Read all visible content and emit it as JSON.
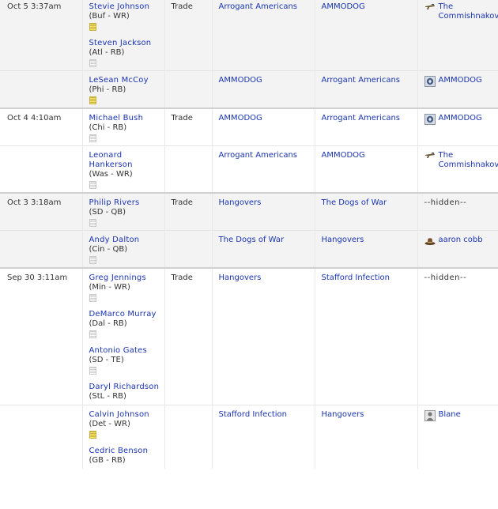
{
  "transactions": [
    {
      "date": "Oct 5 3:37am",
      "type": "Trade",
      "legs": [
        {
          "players": [
            {
              "name": "Stevie Johnson",
              "pos": "(Buf - WR)",
              "note": "yellow"
            },
            {
              "name": "Steven Jackson",
              "pos": "(Atl - RB)",
              "note": "plain"
            }
          ],
          "from": "Arrogant Americans",
          "to": "AMMODOG",
          "manager": "The Commishnakov",
          "manager_icon": "gun-icon"
        },
        {
          "players": [
            {
              "name": "LeSean McCoy",
              "pos": "(Phi - RB)",
              "note": "yellow"
            }
          ],
          "from": "AMMODOG",
          "to": "Arrogant Americans",
          "manager": "AMMODOG",
          "manager_icon": "badge-icon"
        }
      ]
    },
    {
      "date": "Oct 4 4:10am",
      "type": "Trade",
      "legs": [
        {
          "players": [
            {
              "name": "Michael Bush",
              "pos": "(Chi - RB)",
              "note": "plain"
            }
          ],
          "from": "AMMODOG",
          "to": "Arrogant Americans",
          "manager": "AMMODOG",
          "manager_icon": "badge-icon"
        },
        {
          "players": [
            {
              "name": "Leonard Hankerson",
              "pos": "(Was - WR)",
              "note": "plain"
            }
          ],
          "from": "Arrogant Americans",
          "to": "AMMODOG",
          "manager": "The Commishnakov",
          "manager_icon": "gun-icon"
        }
      ]
    },
    {
      "date": "Oct 3 3:18am",
      "type": "Trade",
      "legs": [
        {
          "players": [
            {
              "name": "Philip Rivers",
              "pos": "(SD - QB)",
              "note": "plain"
            }
          ],
          "from": "Hangovers",
          "to": "The Dogs of War",
          "manager": "--hidden--",
          "manager_icon": ""
        },
        {
          "players": [
            {
              "name": "Andy Dalton",
              "pos": "(Cin - QB)",
              "note": "plain"
            }
          ],
          "from": "The Dogs of War",
          "to": "Hangovers",
          "manager": "aaron cobb",
          "manager_icon": "hat-icon"
        }
      ]
    },
    {
      "date": "Sep 30 3:11am",
      "type": "Trade",
      "legs": [
        {
          "players": [
            {
              "name": "Greg Jennings",
              "pos": "(Min - WR)",
              "note": "plain"
            },
            {
              "name": "DeMarco Murray",
              "pos": "(Dal - RB)",
              "note": "plain"
            },
            {
              "name": "Antonio Gates",
              "pos": "(SD - TE)",
              "note": "plain"
            },
            {
              "name": "Daryl Richardson",
              "pos": "(StL - RB)",
              "note": "none"
            }
          ],
          "from": "Hangovers",
          "to": "Stafford Infection",
          "manager": "--hidden--",
          "manager_icon": ""
        },
        {
          "players": [
            {
              "name": "Calvin Johnson",
              "pos": "(Det - WR)",
              "note": "yellow"
            },
            {
              "name": "Cedric Benson",
              "pos": "(GB - RB)",
              "note": "none"
            }
          ],
          "from": "Stafford Infection",
          "to": "Hangovers",
          "manager": "Blane",
          "manager_icon": "person-icon"
        }
      ]
    }
  ]
}
